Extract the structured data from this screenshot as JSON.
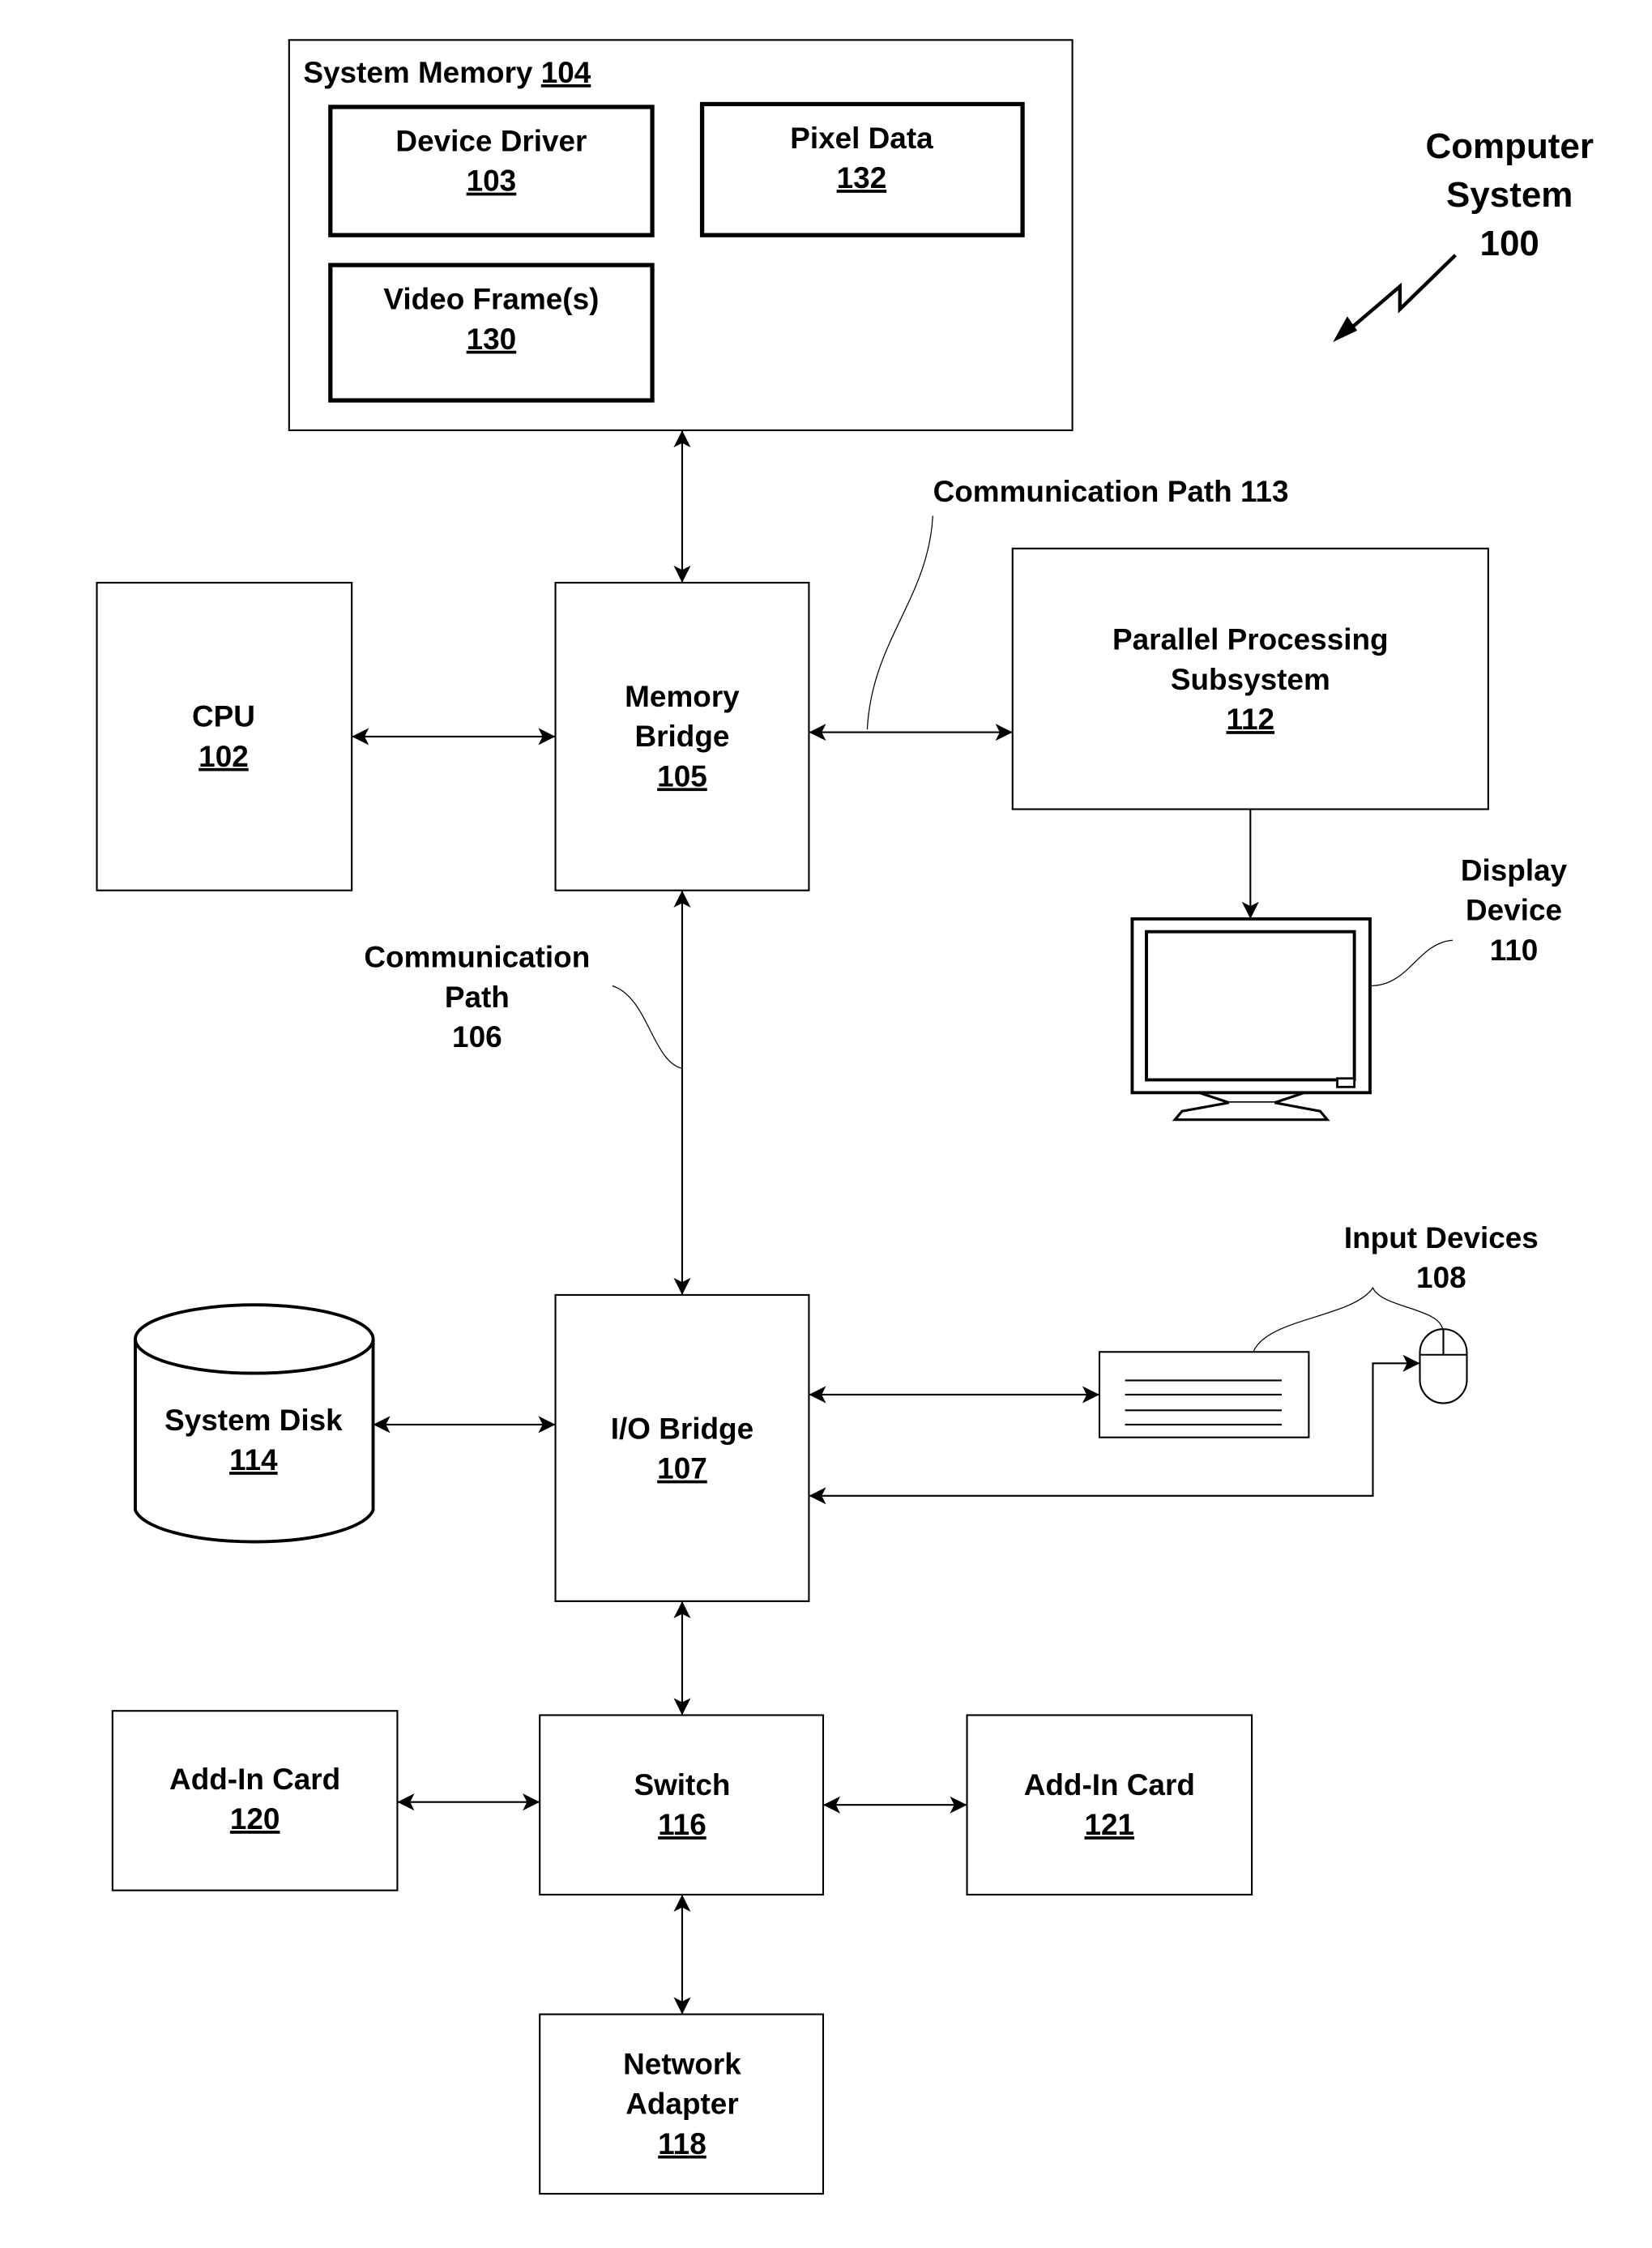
{
  "figure": {
    "title_lines": [
      "Computer",
      "System",
      "100"
    ]
  },
  "system_memory": {
    "label": "System Memory",
    "ref": "104",
    "children": {
      "device_driver": {
        "label": "Device Driver",
        "ref": "103"
      },
      "pixel_data": {
        "label": "Pixel Data",
        "ref": "132"
      },
      "video_frames": {
        "label": "Video Frame(s)",
        "ref": "130"
      }
    }
  },
  "cpu": {
    "label": "CPU",
    "ref": "102"
  },
  "memory_bridge": {
    "label_lines": [
      "Memory",
      "Bridge"
    ],
    "ref": "105"
  },
  "parallel_processing": {
    "label_lines": [
      "Parallel Processing",
      "Subsystem"
    ],
    "ref": "112"
  },
  "comm_path_113": {
    "label": "Communication Path 113"
  },
  "comm_path_106": {
    "label_lines": [
      "Communication",
      "Path",
      "106"
    ]
  },
  "display_device": {
    "label_lines": [
      "Display",
      "Device",
      "110"
    ]
  },
  "input_devices": {
    "label_lines": [
      "Input Devices",
      "108"
    ]
  },
  "io_bridge": {
    "label": "I/O Bridge",
    "ref": "107"
  },
  "system_disk": {
    "label": "System Disk",
    "ref": "114"
  },
  "switch": {
    "label": "Switch",
    "ref": "116"
  },
  "add_in_card_120": {
    "label": "Add-In Card",
    "ref": "120"
  },
  "add_in_card_121": {
    "label": "Add-In Card",
    "ref": "121"
  },
  "network_adapter": {
    "label_lines": [
      "Network",
      "Adapter"
    ],
    "ref": "118"
  }
}
